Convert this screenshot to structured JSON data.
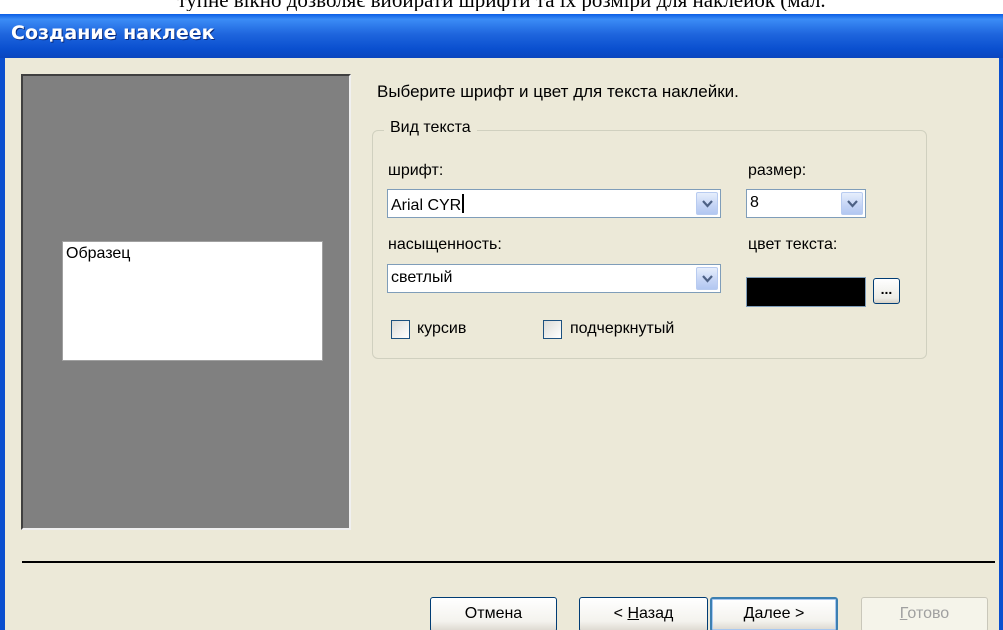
{
  "caption": "тупне вікно дозволяє вибирати шрифти та їх розміри для наклейок (мал.",
  "window": {
    "title": "Создание наклеек"
  },
  "preview": {
    "sample_text": "Образец"
  },
  "instruction": "Выберите шрифт и цвет для текста наклейки.",
  "text_group": {
    "legend": "Вид текста",
    "font": {
      "label": "шрифт:",
      "value": "Arial CYR"
    },
    "size": {
      "label": "размер:",
      "value": "8"
    },
    "weight": {
      "label": "насыщенность:",
      "value": "светлый"
    },
    "color": {
      "label": "цвет текста:",
      "value": "#000000",
      "button_label": "..."
    },
    "italic": {
      "label": "курсив",
      "checked": false
    },
    "underline": {
      "label": "подчеркнутый",
      "checked": false
    }
  },
  "buttons": {
    "cancel": "Отмена",
    "back_prefix": "< ",
    "back_hotkey": "Н",
    "back_rest": "азад",
    "next_hotkey": "Д",
    "next_rest": "алее >",
    "finish_hotkey": "Г",
    "finish_rest": "отово"
  },
  "colors": {
    "titlebar": "#0A5EE6",
    "dialog_bg": "#ECE9D8",
    "preview_bg": "#808080"
  }
}
